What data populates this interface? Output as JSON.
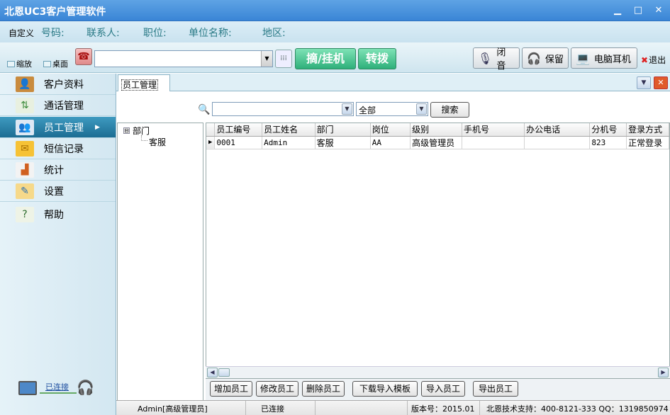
{
  "window": {
    "title": "北恩UC3客户管理软件",
    "minimize": "▁",
    "maximize": "□",
    "close": "✕"
  },
  "info_bar": {
    "customize": "自定义",
    "labels": [
      "号码:",
      "联系人:",
      "职位:",
      "单位名称:",
      "地区:"
    ]
  },
  "toolbar": {
    "shrink_label": "缩放",
    "desktop_label": "桌面",
    "phone_number_value": "",
    "pickup_label": "摘/挂机",
    "transfer_label": "转拨",
    "mute_label": "闭音",
    "hold_label": "保留",
    "pc_headset_label": "电脑耳机",
    "exit_label": "退出"
  },
  "sidebar": {
    "items": [
      {
        "label": "客户资料",
        "icon": "customer-icon"
      },
      {
        "label": "通话管理",
        "icon": "call-icon"
      },
      {
        "label": "员工管理",
        "icon": "staff-icon",
        "active": true
      },
      {
        "label": "短信记录",
        "icon": "envelope-icon"
      },
      {
        "label": "统计",
        "icon": "chart-icon"
      },
      {
        "label": "设置",
        "icon": "settings-icon"
      },
      {
        "label": "帮助",
        "icon": "help-icon"
      }
    ],
    "connection_status": "已连接"
  },
  "tab": {
    "label": "员工管理"
  },
  "search": {
    "keyword_value": "",
    "scope_value": "全部",
    "button_label": "搜索"
  },
  "tree": {
    "root": "部门",
    "child": "客服",
    "expander": "⊟"
  },
  "table": {
    "columns": [
      "员工编号",
      "员工姓名",
      "部门",
      "岗位",
      "级别",
      "手机号",
      "办公电话",
      "分机号",
      "登录方式"
    ],
    "rows": [
      [
        "0001",
        "Admin",
        "客服",
        "AA",
        "高级管理员",
        "",
        "",
        "823",
        "正常登录"
      ]
    ]
  },
  "actions": {
    "add": "增加员工",
    "edit": "修改员工",
    "delete": "删除员工",
    "download_template": "下载导入模板",
    "import": "导入员工",
    "export": "导出员工"
  },
  "status_bar": {
    "user": "Admin[高级管理员]",
    "connection": "已连接",
    "version": "版本号：2015.01",
    "support": "北恩技术支持：400-8121-333 QQ：1319850974"
  },
  "colors": {
    "title_bar": "#3a85d6",
    "active_nav": "#1c6d93",
    "green_button": "#2eb07a",
    "info_label": "#2a7a86"
  }
}
